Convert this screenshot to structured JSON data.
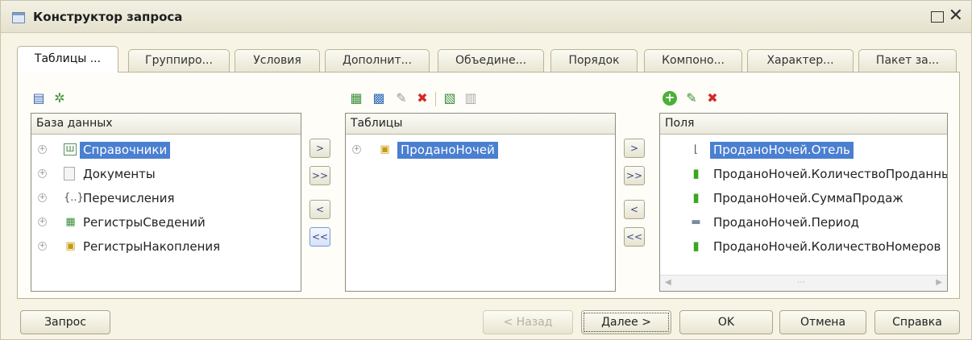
{
  "window": {
    "title": "Конструктор запроса",
    "icon": "window-icon",
    "maximize_icon": "maximize-icon",
    "close_icon": "close-icon"
  },
  "tabs": [
    {
      "label": "Таблицы ...",
      "active": true
    },
    {
      "label": "Группиро..."
    },
    {
      "label": "Условия"
    },
    {
      "label": "Дополнит..."
    },
    {
      "label": "Объедине..."
    },
    {
      "label": "Порядок"
    },
    {
      "label": "Компоно..."
    },
    {
      "label": "Характер..."
    },
    {
      "label": "Пакет за..."
    }
  ],
  "database_panel": {
    "header": "База данных",
    "toolbar": [
      "list-icon",
      "refresh-tree-icon"
    ],
    "items": [
      {
        "label": "Справочники",
        "icon": "catalog-icon",
        "selected": true
      },
      {
        "label": "Документы",
        "icon": "document-icon"
      },
      {
        "label": "Перечисления",
        "icon": "enum-icon"
      },
      {
        "label": "РегистрыСведений",
        "icon": "info-register-icon"
      },
      {
        "label": "РегистрыНакопления",
        "icon": "accumulation-register-icon"
      }
    ]
  },
  "move_left": {
    "add": ">",
    "add_all": ">>",
    "remove": "<",
    "remove_all": "<<"
  },
  "tables_panel": {
    "header": "Таблицы",
    "toolbar": [
      "add-table-icon",
      "add-subquery-icon",
      "edit-icon",
      "delete-icon",
      "replace-table-icon",
      "rename-icon"
    ],
    "items": [
      {
        "label": "ПроданоНочей",
        "icon": "register-table-icon",
        "selected": true
      }
    ]
  },
  "move_right": {
    "add": ">",
    "add_all": ">>",
    "remove": "<",
    "remove_all": "<<"
  },
  "fields_panel": {
    "header": "Поля",
    "toolbar": [
      "add-icon",
      "edit-icon",
      "delete-icon"
    ],
    "items": [
      {
        "label": "ПроданоНочей.Отель",
        "icon": "dimension-icon",
        "selected": true
      },
      {
        "label": "ПроданоНочей.КоличествоПроданных",
        "icon": "resource-icon"
      },
      {
        "label": "ПроданоНочей.СуммаПродаж",
        "icon": "resource-icon"
      },
      {
        "label": "ПроданоНочей.Период",
        "icon": "attribute-icon"
      },
      {
        "label": "ПроданоНочей.КоличествоНомеров",
        "icon": "resource-icon"
      }
    ]
  },
  "buttons": {
    "query": "Запрос",
    "back": "< Назад",
    "next": "Далее >",
    "ok": "OK",
    "cancel": "Отмена",
    "help": "Справка"
  },
  "colors": {
    "selection": "#4a7fd1",
    "background": "#f7f4e6",
    "resource_green": "#3aa61f",
    "delete_red": "#d12a2a"
  }
}
